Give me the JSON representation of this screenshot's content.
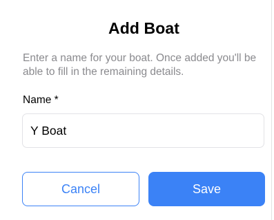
{
  "dialog": {
    "title": "Add Boat",
    "description": "Enter a name for your boat. Once added you'll be able to fill in the remaining details.",
    "name_label": "Name *",
    "name_value": "Y Boat",
    "cancel_label": "Cancel",
    "save_label": "Save"
  },
  "colors": {
    "accent": "#3b82f6",
    "muted_text": "#8a8a8e",
    "input_border": "#e2e2e6"
  }
}
